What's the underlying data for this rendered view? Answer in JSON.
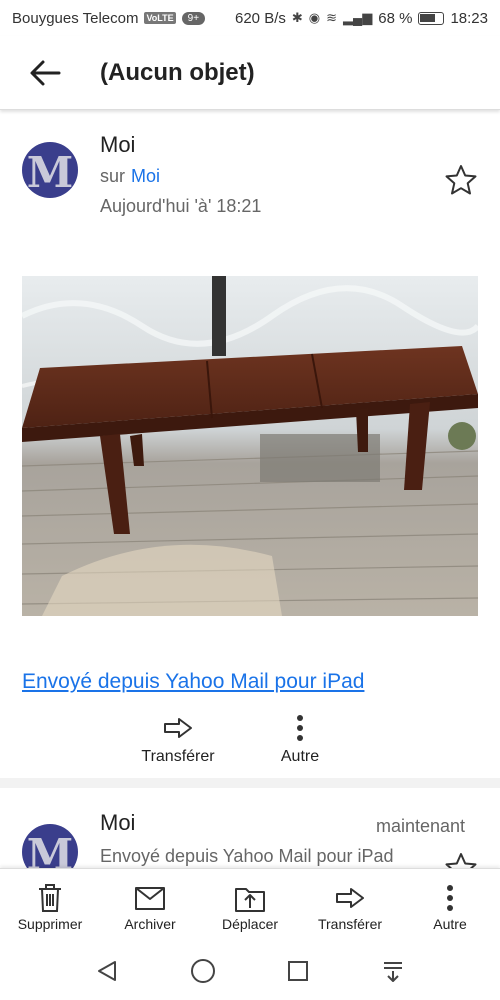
{
  "status_bar": {
    "carrier": "Bouygues Telecom",
    "volte": "VoLTE",
    "notifications": "9+",
    "speed": "620 B/s",
    "battery": "68 %",
    "time": "18:23"
  },
  "app_bar": {
    "title": "(Aucun objet)"
  },
  "message1": {
    "sender": "Moi",
    "to_prefix": "sur",
    "recipient": "Moi",
    "date": "Aujourd'hui 'à' 18:21",
    "avatar_letter": "M",
    "signature_link": "Envoyé depuis Yahoo Mail pour iPad",
    "actions": {
      "forward": "Transférer",
      "other": "Autre"
    }
  },
  "message2": {
    "sender": "Moi",
    "time": "maintenant",
    "snippet": "Envoyé depuis Yahoo Mail pour iPad",
    "avatar_letter": "M"
  },
  "toolbar": {
    "delete": "Supprimer",
    "archive": "Archiver",
    "move": "Déplacer",
    "forward": "Transférer",
    "other": "Autre"
  },
  "colors": {
    "link": "#1a73e8",
    "avatar_bg": "#3a3e8c",
    "wood": "#5a2a1c"
  }
}
